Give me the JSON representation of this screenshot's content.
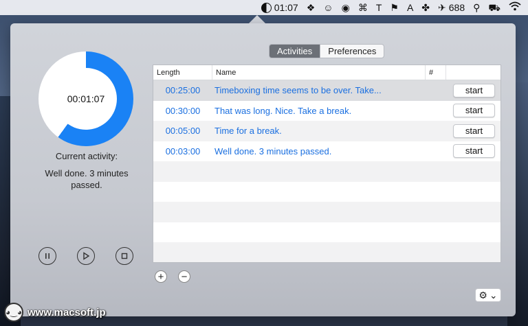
{
  "menubar": {
    "clock": "01:07",
    "badge_count": "688",
    "icons": [
      "timer-pie-icon",
      "dropbox-icon",
      "alfred-icon",
      "line-icon",
      "app-icon",
      "text-icon",
      "flag-icon",
      "a-icon",
      "clover-icon",
      "plane-icon",
      "figure-icon",
      "train-icon",
      "wifi-icon"
    ]
  },
  "timer": {
    "display": "00:01:07",
    "progress_fraction": 0.6,
    "ring_color": "#1a82f5",
    "current_label": "Current activity:",
    "current_activity": "Well done. 3 minutes passed."
  },
  "tabs": [
    {
      "label": "Activities",
      "active": true
    },
    {
      "label": "Preferences",
      "active": false
    }
  ],
  "table": {
    "columns": [
      "Length",
      "Name",
      "#",
      ""
    ],
    "rows": [
      {
        "length": "00:25:00",
        "name": "Timeboxing time seems to be over. Take...",
        "count": "",
        "button": "start"
      },
      {
        "length": "00:30:00",
        "name": "That was long. Nice. Take a break.",
        "count": "",
        "button": "start"
      },
      {
        "length": "00:05:00",
        "name": "Time for a break.",
        "count": "",
        "button": "start"
      },
      {
        "length": "00:03:00",
        "name": "Well done. 3 minutes passed.",
        "count": "",
        "button": "start"
      }
    ],
    "empty_rows": 5
  },
  "controls": {
    "add": "+",
    "remove": "−",
    "gear": "⚙",
    "gear_chevron": "⌄"
  },
  "watermark": {
    "text": "www.macsoft.jp"
  }
}
